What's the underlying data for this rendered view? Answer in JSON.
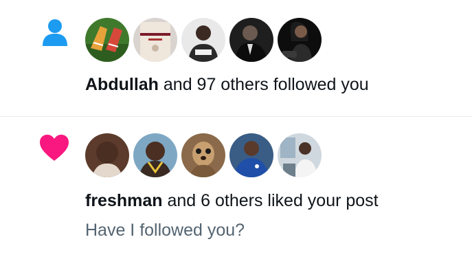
{
  "notifications": [
    {
      "type": "follow",
      "icon": "person-icon",
      "icon_color": "#1d9bf0",
      "name": "Abdullah",
      "action": " and 97 others followed you"
    },
    {
      "type": "like",
      "icon": "heart-icon",
      "icon_color": "#f91880",
      "name": "freshman",
      "action": " and 6 others liked your post",
      "post_preview": "Have I followed you?"
    }
  ]
}
